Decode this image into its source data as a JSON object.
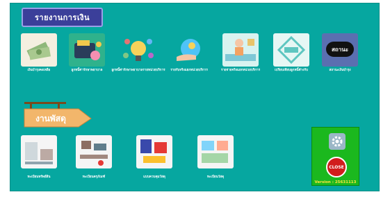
{
  "header": {
    "title": "รายงานการเงิน"
  },
  "top_row": [
    {
      "label": "เงินบำรุงคงเหลือ",
      "icon": "money-icon"
    },
    {
      "label": "ลูกหนี้ค่ารักษาพยาบาล",
      "icon": "wallet-icon"
    },
    {
      "label": "ลูกหนี้ค่ารักษาพยาบาลรายหน่วยบริการ",
      "icon": "idea-icon"
    },
    {
      "label": "รายรับจริงแยกหน่วยบริการ",
      "icon": "hand-coin-icon"
    },
    {
      "label": "รายจ่ายจริงแยกหน่วยบริการ",
      "icon": "worker-icon"
    },
    {
      "label": "เปรียบเทียบลูกหนี้ค้างรับ",
      "icon": "compare-icon"
    },
    {
      "label": "สถานะเงินบำรุง",
      "icon": "status-logo-icon"
    }
  ],
  "status_logo_text": "สถานะ",
  "section_sign": {
    "text": "งานพัสดุ"
  },
  "bottom_row": [
    {
      "label": "ทะเบียนทรัพย์สิน",
      "icon": "furniture-icon"
    },
    {
      "label": "ทะเบียนครุภัณฑ์",
      "icon": "office-icon"
    },
    {
      "label": "แบบควบคุมวัสดุ",
      "icon": "supplies-icon"
    },
    {
      "label": "ทะเบียนวัสดุ",
      "icon": "stationery-icon"
    }
  ],
  "settings": {
    "close_text": "CLOSE",
    "version": "Version : 25631113"
  },
  "colors": {
    "background": "#06a7a0",
    "title_bg": "#3b3f9a",
    "panel": "#1bb81e",
    "close": "#d11d1d",
    "version_text": "#ffe23d"
  }
}
